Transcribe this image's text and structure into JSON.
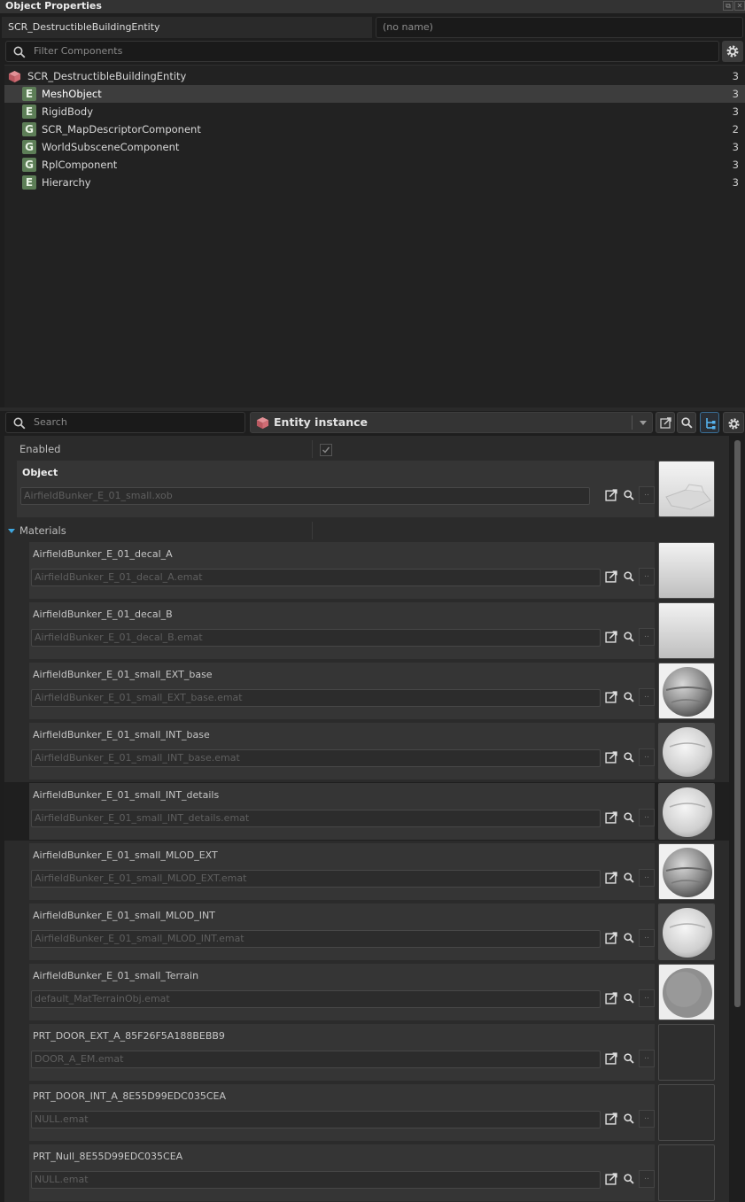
{
  "window": {
    "title": "Object Properties"
  },
  "header": {
    "entity_class": "SCR_DestructibleBuildingEntity",
    "entity_name": "(no name)"
  },
  "filter": {
    "placeholder": "Filter Components"
  },
  "components": {
    "root": {
      "label": "SCR_DestructibleBuildingEntity",
      "count": "3",
      "icon": "cube-icon"
    },
    "items": [
      {
        "badge": "E",
        "label": "MeshObject",
        "count": "3"
      },
      {
        "badge": "E",
        "label": "RigidBody",
        "count": "3"
      },
      {
        "badge": "G",
        "label": "SCR_MapDescriptorComponent",
        "count": "2"
      },
      {
        "badge": "G",
        "label": "WorldSubsceneComponent",
        "count": "3"
      },
      {
        "badge": "G",
        "label": "RplComponent",
        "count": "3"
      },
      {
        "badge": "E",
        "label": "Hierarchy",
        "count": "3"
      }
    ]
  },
  "property_toolbar": {
    "search_placeholder": "Search",
    "scope_selected": "Entity instance"
  },
  "properties": {
    "enabled_label": "Enabled",
    "enabled_checked": true,
    "object": {
      "label": "Object",
      "path": "AirfieldBunker_E_01_small.xob"
    },
    "materials_label": "Materials",
    "materials": [
      {
        "label": "AirfieldBunker_E_01_decal_A",
        "path": "AirfieldBunker_E_01_decal_A.emat",
        "thumb": "gradient"
      },
      {
        "label": "AirfieldBunker_E_01_decal_B",
        "path": "AirfieldBunker_E_01_decal_B.emat",
        "thumb": "gradient"
      },
      {
        "label": "AirfieldBunker_E_01_small_EXT_base",
        "path": "AirfieldBunker_E_01_small_EXT_base.emat",
        "thumb": "sphere-dark"
      },
      {
        "label": "AirfieldBunker_E_01_small_INT_base",
        "path": "AirfieldBunker_E_01_small_INT_base.emat",
        "thumb": "sphere-light"
      },
      {
        "label": "AirfieldBunker_E_01_small_INT_details",
        "path": "AirfieldBunker_E_01_small_INT_details.emat",
        "thumb": "sphere-light"
      },
      {
        "label": "AirfieldBunker_E_01_small_MLOD_EXT",
        "path": "AirfieldBunker_E_01_small_MLOD_EXT.emat",
        "thumb": "sphere-dark"
      },
      {
        "label": "AirfieldBunker_E_01_small_MLOD_INT",
        "path": "AirfieldBunker_E_01_small_MLOD_INT.emat",
        "thumb": "sphere-light"
      },
      {
        "label": "AirfieldBunker_E_01_small_Terrain",
        "path": "default_MatTerrainObj.emat",
        "thumb": "sphere-flat"
      },
      {
        "label": "PRT_DOOR_EXT_A_85F26F5A188BEBB9",
        "path": "DOOR_A_EM.emat",
        "thumb": "none"
      },
      {
        "label": "PRT_DOOR_INT_A_8E55D99EDC035CEA",
        "path": "NULL.emat",
        "thumb": "none"
      },
      {
        "label": "PRT_Null_8E55D99EDC035CEA",
        "path": "NULL.emat",
        "thumb": "none"
      }
    ],
    "picker_label": ".."
  },
  "colors": {
    "badge_green": "#5d7e57",
    "accent_blue": "#3fa7e0",
    "cube_red": "#c9666e"
  }
}
